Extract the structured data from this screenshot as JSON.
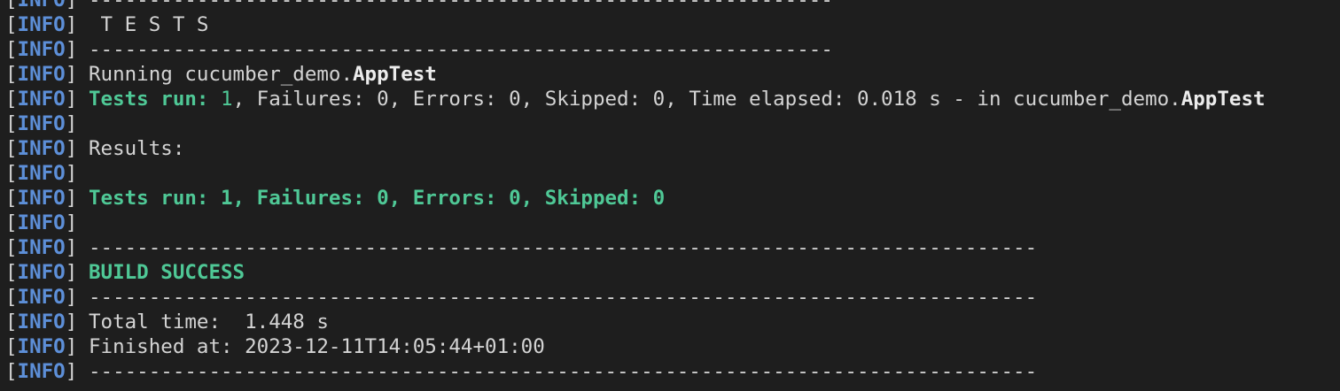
{
  "terminal": {
    "lines": [
      {
        "level": "INFO",
        "segments": [
          {
            "text": "--------------------------------------------------------------",
            "style": "dim"
          }
        ]
      },
      {
        "level": "INFO",
        "segments": [
          {
            "text": " T E S T S",
            "style": "dim"
          }
        ]
      },
      {
        "level": "INFO",
        "segments": [
          {
            "text": "--------------------------------------------------------------",
            "style": "dim"
          }
        ]
      },
      {
        "level": "INFO",
        "segments": [
          {
            "text": "Running cucumber_demo.",
            "style": "dim"
          },
          {
            "text": "AppTest",
            "style": "white bold"
          }
        ]
      },
      {
        "level": "INFO",
        "segments": [
          {
            "text": "Tests run: ",
            "style": "green bold"
          },
          {
            "text": "1",
            "style": "green"
          },
          {
            "text": ", Failures: 0, Errors: 0, Skipped: 0, Time elapsed: 0.018 s - in cucumber_demo.",
            "style": "dim"
          },
          {
            "text": "AppTest",
            "style": "white bold"
          }
        ]
      },
      {
        "level": "INFO",
        "segments": []
      },
      {
        "level": "INFO",
        "segments": [
          {
            "text": "Results:",
            "style": "dim"
          }
        ]
      },
      {
        "level": "INFO",
        "segments": []
      },
      {
        "level": "INFO",
        "segments": [
          {
            "text": "Tests run: 1, Failures: 0, Errors: 0, Skipped: 0",
            "style": "green bold"
          }
        ]
      },
      {
        "level": "INFO",
        "segments": []
      },
      {
        "level": "INFO",
        "segments": [
          {
            "text": "-------------------------------------------------------------------------------",
            "style": "dim"
          }
        ]
      },
      {
        "level": "INFO",
        "segments": [
          {
            "text": "BUILD SUCCESS",
            "style": "green bold"
          }
        ]
      },
      {
        "level": "INFO",
        "segments": [
          {
            "text": "-------------------------------------------------------------------------------",
            "style": "dim"
          }
        ]
      },
      {
        "level": "INFO",
        "segments": [
          {
            "text": "Total time:  1.448 s",
            "style": "dim"
          }
        ]
      },
      {
        "level": "INFO",
        "segments": [
          {
            "text": "Finished at: 2023-12-11T14:05:44+01:00",
            "style": "dim"
          }
        ]
      },
      {
        "level": "INFO",
        "segments": [
          {
            "text": "-------------------------------------------------------------------------------",
            "style": "dim"
          }
        ]
      }
    ]
  }
}
